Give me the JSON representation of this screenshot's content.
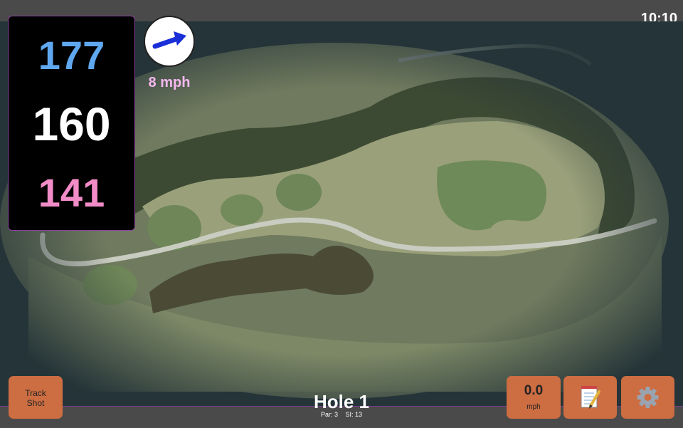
{
  "status": {
    "time": "10:10"
  },
  "distances": {
    "back": "177",
    "middle": "160",
    "front": "141"
  },
  "wind": {
    "speed_label": "8 mph",
    "direction_icon": "wind-arrow-icon"
  },
  "hole": {
    "title": "Hole 1",
    "par": "Par: 3",
    "stroke_index": "SI: 13"
  },
  "buttons": {
    "track_shot": "Track\nShot",
    "speed_value": "0.0",
    "speed_unit": "mph",
    "notes_icon": "notepad-icon",
    "settings_icon": "gear-icon"
  },
  "colors": {
    "back_distance": "#5fa8f0",
    "middle_distance": "#ffffff",
    "front_distance": "#f28cc8",
    "wind_text": "#f5b8f0",
    "button_bg": "#cc6d42",
    "accent_border": "#8a3fa0"
  }
}
